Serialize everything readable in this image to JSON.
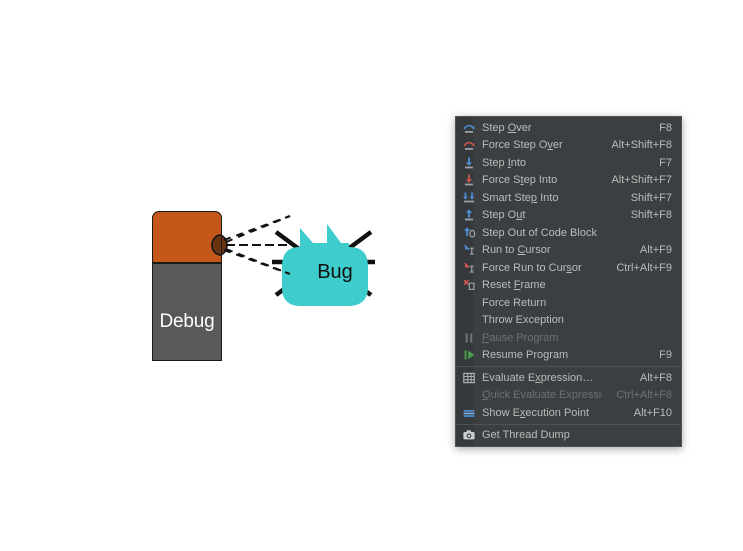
{
  "illustration": {
    "debug_block": {
      "label": "Debug",
      "top_color": "#C4571A",
      "bottom_color": "#595959",
      "outline_color": "#1a1a1a"
    },
    "bug": {
      "label": "Bug",
      "body_color": "#3FCCCC",
      "leg_color": "#111111"
    },
    "connector": {
      "style": "dashed",
      "color": "#111111",
      "count": 3
    }
  },
  "context_menu": {
    "background": "#3C3F41",
    "gutter": "#36393B",
    "text_color": "#BBBBBB",
    "disabled_color": "#6E7173",
    "separator_color": "#4E5254",
    "items": [
      {
        "label": "Step Over",
        "mnemonic": "O",
        "shortcut": "F8",
        "icon": "step-over-icon",
        "enabled": true,
        "separator_before": false
      },
      {
        "label": "Force Step Over",
        "mnemonic": "v",
        "shortcut": "Alt+Shift+F8",
        "icon": "force-step-over-icon",
        "enabled": true,
        "separator_before": false
      },
      {
        "label": "Step Into",
        "mnemonic": "I",
        "shortcut": "F7",
        "icon": "step-into-icon",
        "enabled": true,
        "separator_before": false
      },
      {
        "label": "Force Step Into",
        "mnemonic": "t",
        "shortcut": "Alt+Shift+F7",
        "icon": "force-step-into-icon",
        "enabled": true,
        "separator_before": false
      },
      {
        "label": "Smart Step Into",
        "mnemonic": "p",
        "shortcut": "Shift+F7",
        "icon": "smart-step-into-icon",
        "enabled": true,
        "separator_before": false
      },
      {
        "label": "Step Out",
        "mnemonic": "u",
        "shortcut": "Shift+F8",
        "icon": "step-out-icon",
        "enabled": true,
        "separator_before": false
      },
      {
        "label": "Step Out of Code Block",
        "mnemonic": "",
        "shortcut": "",
        "icon": "step-out-of-code-block-icon",
        "enabled": true,
        "separator_before": false
      },
      {
        "label": "Run to Cursor",
        "mnemonic": "C",
        "shortcut": "Alt+F9",
        "icon": "run-to-cursor-icon",
        "enabled": true,
        "separator_before": false
      },
      {
        "label": "Force Run to Cursor",
        "mnemonic": "s",
        "shortcut": "Ctrl+Alt+F9",
        "icon": "force-run-to-cursor-icon",
        "enabled": true,
        "separator_before": false
      },
      {
        "label": "Reset Frame",
        "mnemonic": "F",
        "shortcut": "",
        "icon": "reset-frame-icon",
        "enabled": true,
        "separator_before": false
      },
      {
        "label": "Force Return",
        "mnemonic": "",
        "shortcut": "",
        "icon": "none",
        "enabled": true,
        "separator_before": false
      },
      {
        "label": "Throw Exception",
        "mnemonic": "",
        "shortcut": "",
        "icon": "none",
        "enabled": true,
        "separator_before": false
      },
      {
        "label": "Pause Program",
        "mnemonic": "P",
        "shortcut": "",
        "icon": "pause-icon",
        "enabled": false,
        "separator_before": false
      },
      {
        "label": "Resume Program",
        "mnemonic": "",
        "shortcut": "F9",
        "icon": "resume-icon",
        "enabled": true,
        "separator_before": false
      },
      {
        "label": "Evaluate Expression…",
        "mnemonic": "x",
        "shortcut": "Alt+F8",
        "icon": "evaluate-expression-icon",
        "enabled": true,
        "separator_before": true
      },
      {
        "label": "Quick Evaluate Expression",
        "mnemonic": "Q",
        "shortcut": "Ctrl+Alt+F8",
        "icon": "none",
        "enabled": false,
        "separator_before": false
      },
      {
        "label": "Show Execution Point",
        "mnemonic": "x",
        "shortcut": "Alt+F10",
        "icon": "show-execution-point-icon",
        "enabled": true,
        "separator_before": false
      },
      {
        "label": "Get Thread Dump",
        "mnemonic": "",
        "shortcut": "",
        "icon": "thread-dump-icon",
        "enabled": true,
        "separator_before": true
      }
    ]
  }
}
